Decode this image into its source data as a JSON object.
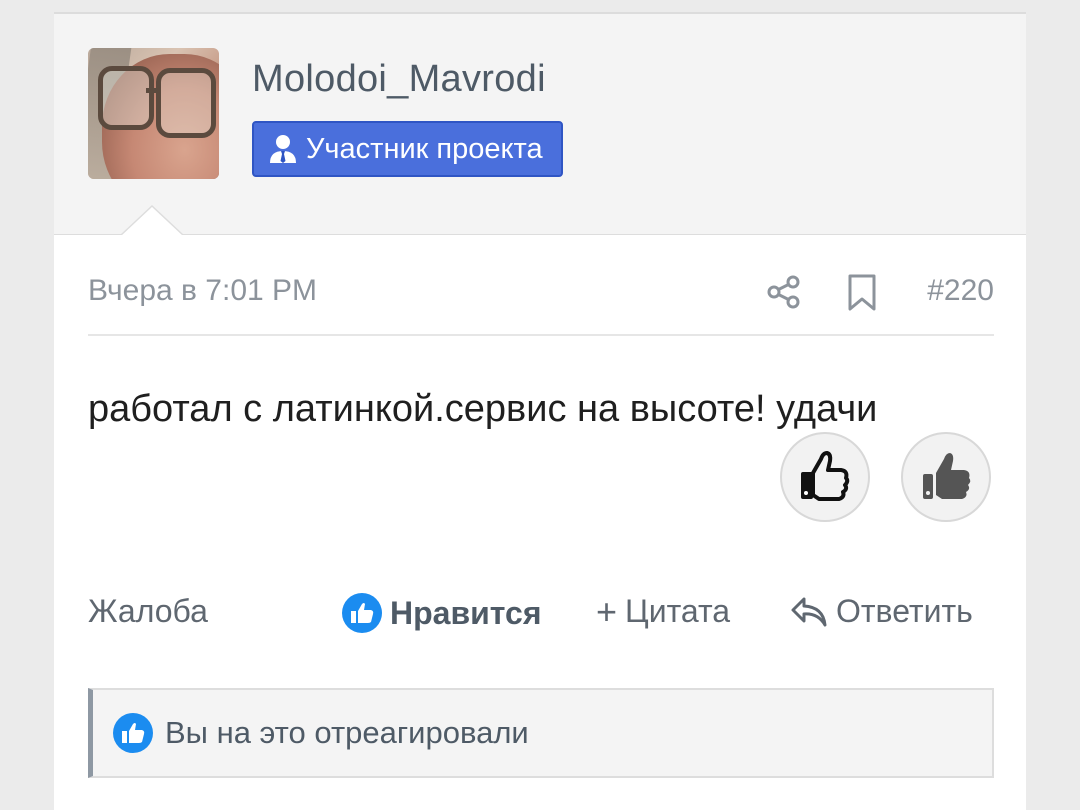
{
  "user": {
    "name": "Molodoi_Mavrodi",
    "badge_label": "Участник проекта",
    "badge_icon": "user-tie-icon",
    "badge_color": "#4a6fdc"
  },
  "post": {
    "date": "Вчера в 7:01 PM",
    "number": "#220",
    "message": "работал с латинкой.сервис на высоте! удачи"
  },
  "icons": {
    "share": "share-icon",
    "bookmark": "bookmark-icon",
    "like_reaction": "thumbs-up-outline-icon",
    "dislike_reaction": "thumbs-up-filled-icon"
  },
  "actions": {
    "complaint": "Жалоба",
    "like": "Нравится",
    "quote_prefix": "+",
    "quote": "Цитата",
    "reply": "Ответить",
    "like_color": "#1b8cf0"
  },
  "reaction_notice": {
    "text": "Вы на это отреагировали"
  }
}
